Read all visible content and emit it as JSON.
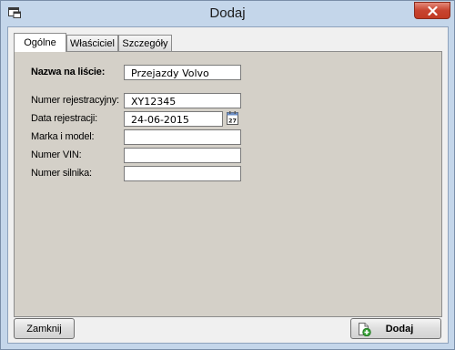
{
  "window": {
    "title": "Dodaj",
    "close_label": "✕"
  },
  "tabs": [
    {
      "label": "Ogólne",
      "active": true
    },
    {
      "label": "Właściciel",
      "active": false
    },
    {
      "label": "Szczegóły",
      "active": false
    }
  ],
  "form": {
    "name_label": "Nazwa na liście:",
    "name_value": "Przejazdy Volvo",
    "registration_number_label": "Numer rejestracyjny:",
    "registration_number_value": "XY12345",
    "registration_date_label": "Data rejestracji:",
    "registration_date_value": "24-06-2015",
    "calendar_day": "27",
    "make_model_label": "Marka i model:",
    "make_model_value": "",
    "vin_label": "Numer VIN:",
    "vin_value": "",
    "engine_number_label": "Numer silnika:",
    "engine_number_value": ""
  },
  "buttons": {
    "close_label": "Zamknij",
    "add_label": "Dodaj"
  },
  "icons": {
    "app": "window-app-icon",
    "calendar": "calendar-icon",
    "add": "add-document-icon"
  }
}
